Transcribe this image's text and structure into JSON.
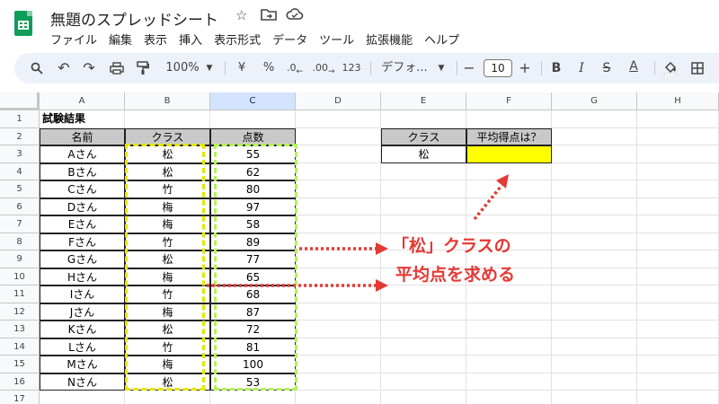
{
  "title_bar": {
    "document_title": "無題のスプレッドシート",
    "star_icon": "star-icon",
    "move_icon": "folder-move-icon",
    "cloud_icon": "cloud-saved-icon"
  },
  "menu": [
    "ファイル",
    "編集",
    "表示",
    "挿入",
    "表示形式",
    "データ",
    "ツール",
    "拡張機能",
    "ヘルプ"
  ],
  "toolbar": {
    "zoom": "100%",
    "currency": "¥",
    "percent": "%",
    "decimal_decrease": ".0",
    "decimal_increase": ".00",
    "number_format": "123",
    "font_name": "デフォ...",
    "font_size": "10",
    "minus": "−",
    "plus": "+",
    "bold": "B",
    "italic": "I",
    "strike": "S",
    "text_color": "A"
  },
  "columns": [
    "A",
    "B",
    "C",
    "D",
    "E",
    "F",
    "G",
    "H"
  ],
  "rows": [
    "1",
    "2",
    "3",
    "4",
    "5",
    "6",
    "7",
    "8",
    "9",
    "10",
    "11",
    "12",
    "13",
    "14",
    "15",
    "16",
    "17"
  ],
  "sheet": {
    "a1": "試験結果",
    "headers": {
      "name": "名前",
      "class": "クラス",
      "score": "点数"
    },
    "records": [
      {
        "name": "Aさん",
        "class": "松",
        "score": "55"
      },
      {
        "name": "Bさん",
        "class": "松",
        "score": "62"
      },
      {
        "name": "Cさん",
        "class": "竹",
        "score": "80"
      },
      {
        "name": "Dさん",
        "class": "梅",
        "score": "97"
      },
      {
        "name": "Eさん",
        "class": "梅",
        "score": "58"
      },
      {
        "name": "Fさん",
        "class": "竹",
        "score": "89"
      },
      {
        "name": "Gさん",
        "class": "松",
        "score": "77"
      },
      {
        "name": "Hさん",
        "class": "梅",
        "score": "65"
      },
      {
        "name": "Iさん",
        "class": "竹",
        "score": "68"
      },
      {
        "name": "Jさん",
        "class": "梅",
        "score": "87"
      },
      {
        "name": "Kさん",
        "class": "松",
        "score": "72"
      },
      {
        "name": "Lさん",
        "class": "竹",
        "score": "81"
      },
      {
        "name": "Mさん",
        "class": "梅",
        "score": "100"
      },
      {
        "name": "Nさん",
        "class": "松",
        "score": "53"
      }
    ],
    "summary": {
      "class_header": "クラス",
      "avg_header": "平均得点は？",
      "class_value": "松",
      "avg_value": ""
    }
  },
  "annotation": {
    "line1": "「松」クラスの",
    "line2": "平均点を求める"
  },
  "colors": {
    "accent_red": "#e53935",
    "yellow_dash": "#e6e600",
    "green_dash": "#b5f25a",
    "highlight_yellow": "#ffff00",
    "header_gray": "#c9c9c9"
  }
}
